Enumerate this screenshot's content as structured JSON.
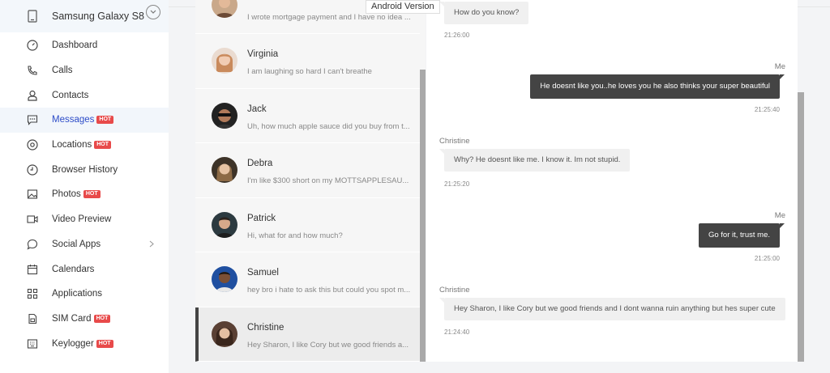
{
  "device": {
    "name": "Samsung Galaxy S8"
  },
  "tooltip": "Android Version",
  "nav": [
    {
      "label": "Dashboard",
      "icon": "gauge-icon",
      "badge": ""
    },
    {
      "label": "Calls",
      "icon": "phone-icon",
      "badge": ""
    },
    {
      "label": "Contacts",
      "icon": "user-icon",
      "badge": ""
    },
    {
      "label": "Messages",
      "icon": "message-icon",
      "badge": "HOT",
      "active": true
    },
    {
      "label": "Locations",
      "icon": "location-icon",
      "badge": "HOT"
    },
    {
      "label": "Browser History",
      "icon": "clock-icon",
      "badge": ""
    },
    {
      "label": "Photos",
      "icon": "image-icon",
      "badge": "HOT"
    },
    {
      "label": "Video Preview",
      "icon": "video-icon",
      "badge": ""
    },
    {
      "label": "Social Apps",
      "icon": "chat-bubble-icon",
      "badge": ""
    },
    {
      "label": "Calendars",
      "icon": "calendar-icon",
      "badge": ""
    },
    {
      "label": "Applications",
      "icon": "apps-grid-icon",
      "badge": ""
    },
    {
      "label": "SIM Card",
      "icon": "sim-card-icon",
      "badge": "HOT"
    },
    {
      "label": "Keylogger",
      "icon": "keyboard-icon",
      "badge": "HOT"
    }
  ],
  "conversations": [
    {
      "name": "",
      "preview": "I wrote mortgage payment and I have no idea ..."
    },
    {
      "name": "Virginia",
      "preview": "I am laughing so hard I can't breathe"
    },
    {
      "name": "Jack",
      "preview": "Uh, how much apple sauce did you buy from t..."
    },
    {
      "name": "Debra",
      "preview": "I'm like $300 short on my MOTTSAPPLESAU..."
    },
    {
      "name": "Patrick",
      "preview": "Hi, what for and how much?"
    },
    {
      "name": "Samuel",
      "preview": "hey bro i hate to ask this but could you spot m..."
    },
    {
      "name": "Christine",
      "preview": "Hey Sharon, I like Cory but we good friends a..."
    }
  ],
  "messages": [
    {
      "dir": "in",
      "sender": "",
      "text": "How do you know?",
      "time": "21:26:00"
    },
    {
      "dir": "out",
      "sender": "Me",
      "text": "He doesnt like you..he loves you he also thinks your super beautiful",
      "time": "21:25:40"
    },
    {
      "dir": "in",
      "sender": "Christine",
      "text": "Why? He doesnt like me. I know it. Im not stupid.",
      "time": "21:25:20"
    },
    {
      "dir": "out",
      "sender": "Me",
      "text": "Go for it, trust me.",
      "time": "21:25:00"
    },
    {
      "dir": "in",
      "sender": "Christine",
      "text": "Hey Sharon, I like Cory but we good friends and I dont wanna ruin anything but hes super cute",
      "time": "21:24:40"
    }
  ]
}
